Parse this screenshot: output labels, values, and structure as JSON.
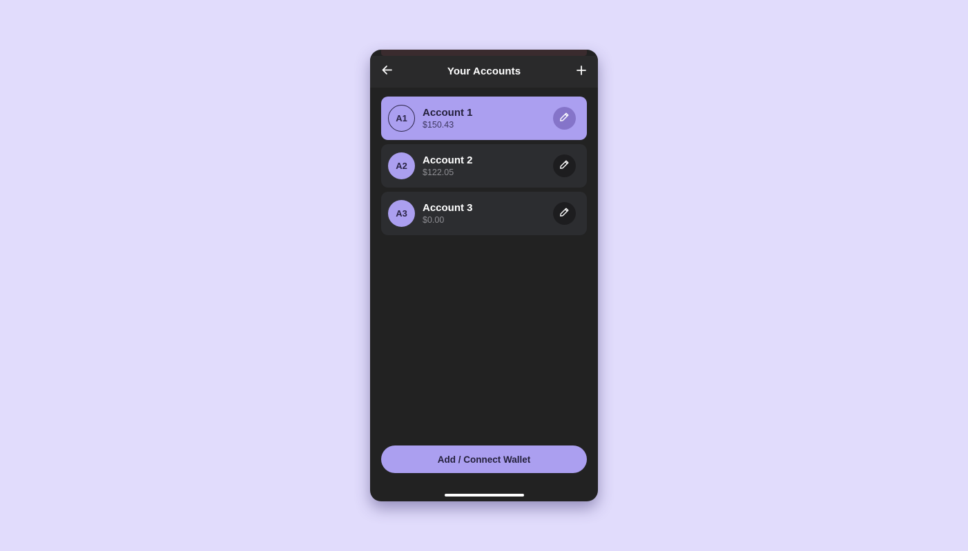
{
  "header": {
    "title": "Your Accounts",
    "back_icon": "arrow-left-icon",
    "add_icon": "plus-icon"
  },
  "accounts": [
    {
      "initials": "A1",
      "name": "Account 1",
      "balance": "$150.43",
      "selected": true
    },
    {
      "initials": "A2",
      "name": "Account 2",
      "balance": "$122.05",
      "selected": false
    },
    {
      "initials": "A3",
      "name": "Account 3",
      "balance": "$0.00",
      "selected": false
    }
  ],
  "edit_icon": "pencil-icon",
  "footer": {
    "button_label": "Add / Connect Wallet"
  },
  "colors": {
    "page_background": "#e1dcfc",
    "phone_background": "#222222",
    "header_background": "#2a2a2b",
    "accent": "#ab9ff0",
    "card_background": "#2c2d30",
    "selected_edit_button": "#8574c9"
  }
}
